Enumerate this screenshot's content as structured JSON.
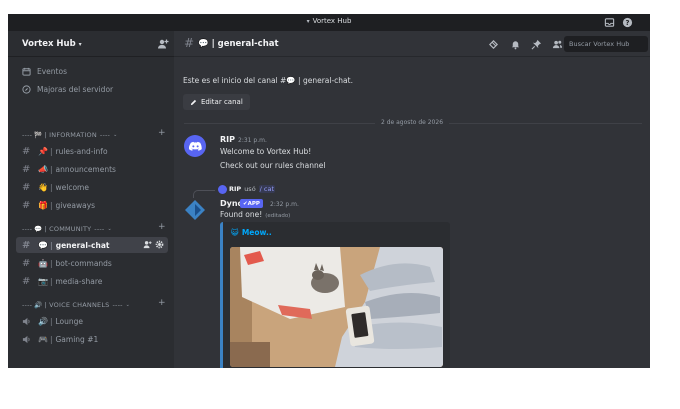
{
  "window": {
    "title": "Vortex Hub"
  },
  "server": {
    "name": "Vortex Hub"
  },
  "nav": [
    {
      "label": "Eventos",
      "icon": "calendar-icon"
    },
    {
      "label": "Majoras del servidor",
      "icon": "compass-icon"
    }
  ],
  "categories": {
    "information": {
      "label": "INFORMATION",
      "prefix": "----",
      "suffix": "----",
      "emoji": "🏁"
    },
    "community": {
      "label": "COMMUNITY",
      "prefix": "----",
      "suffix": "----",
      "emoji": "💬"
    },
    "voice": {
      "label": "VOICE CHANNELS",
      "prefix": "----",
      "suffix": "----",
      "emoji": "🔊"
    }
  },
  "channels": [
    {
      "name": "rules-and-info",
      "emoji": "📌"
    },
    {
      "name": "announcements",
      "emoji": "📣"
    },
    {
      "name": "welcome",
      "emoji": "👋"
    },
    {
      "name": "giveaways",
      "emoji": "🎁"
    },
    {
      "name": "general-chat",
      "emoji": "💬"
    },
    {
      "name": "bot-commands",
      "emoji": "🤖"
    },
    {
      "name": "media-share",
      "emoji": "📷"
    }
  ],
  "voice_channels": [
    {
      "name": "Lounge",
      "emoji": "🔊"
    },
    {
      "name": "Gaming #1",
      "emoji": "🎮"
    }
  ],
  "header": {
    "channel_emoji": "💬",
    "channel_name": "general-chat",
    "search_placeholder": "Buscar Vortex Hub"
  },
  "welcome": {
    "text": "Este es el inicio del canal #💬 | general-chat.",
    "edit_button": "Editar canal"
  },
  "date_divider": "2 de agosto de 2026",
  "messages": [
    {
      "author": "RIP",
      "timestamp": "2:31 p.m.",
      "lines": [
        "Welcome to Vortex Hub!",
        "Check out our rules channel"
      ]
    },
    {
      "reply": {
        "author": "RIP",
        "verb": "usó",
        "command": "/ cat"
      },
      "author": "Dyno",
      "badge": "✔APP",
      "timestamp": "2:32 p.m.",
      "text": "Found one!",
      "edited": "(editado)",
      "embed": {
        "emoji": "😺",
        "title": "Meow.."
      }
    }
  ],
  "colors": {
    "accent": "#5865f2",
    "link": "#00a8fc",
    "background": "#313338",
    "sidebar": "#2b2d31",
    "embed_border": "#3b82c4"
  }
}
